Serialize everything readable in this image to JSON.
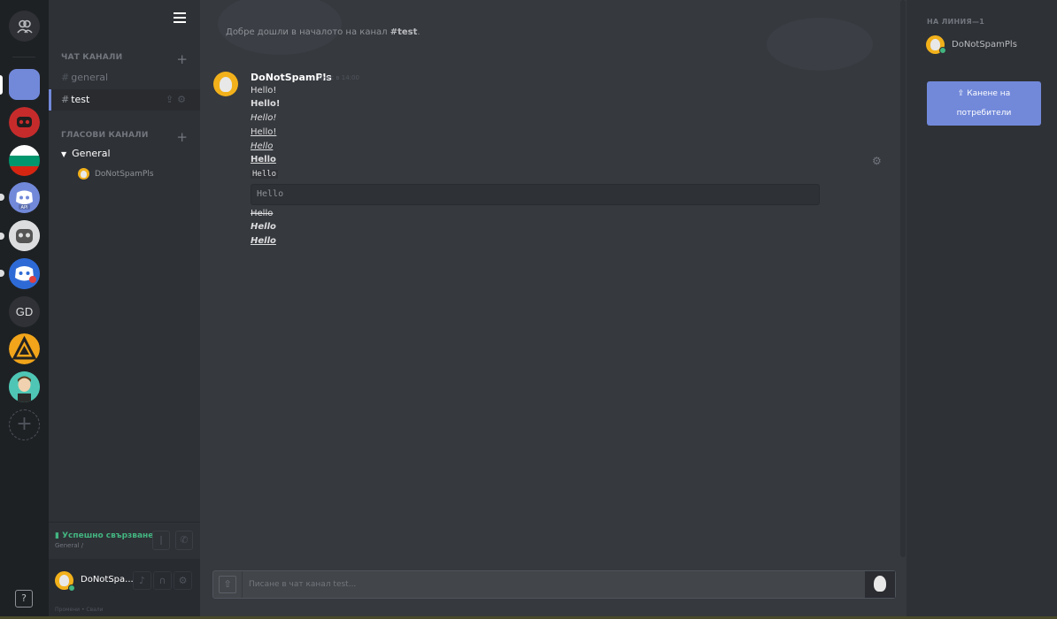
{
  "guilds": {
    "help_label": "?",
    "gd_initials": "GD",
    "add_label": "+"
  },
  "channels": {
    "text_category": "ЧАТ КАНАЛИ",
    "voice_category": "ГЛАСОВИ КАНАЛИ",
    "text_channels": [
      {
        "name": "general"
      },
      {
        "name": "test"
      }
    ],
    "voice_channel": "General",
    "voice_user": "DoNotSpamPls",
    "voice_status": "Успешно свързване",
    "voice_sub": "General /",
    "user_name": "DoNotSpa...",
    "footer": "Промени • Свали"
  },
  "chat": {
    "welcome_prefix": "Добре дошли в началото на канал ",
    "welcome_channel": "#test",
    "welcome_suffix": ".",
    "message": {
      "author": "DoNotSpamPls",
      "timestamp": "Днес в 14:00",
      "lines": [
        "Hello!",
        "Hello!",
        "Hello!",
        "Hello!",
        "Hello",
        "Hello",
        "Hello",
        "Hello",
        "Hello",
        "Hello",
        "Hello"
      ]
    },
    "input_placeholder": "Писане в чат канал test..."
  },
  "members": {
    "header": "НА ЛИНИЯ—1",
    "online": [
      {
        "name": "DoNotSpamPls"
      }
    ],
    "invite_line1": "Канене на",
    "invite_line2": "потребители"
  },
  "colors": {
    "accent": "#7289da",
    "online": "#43b581",
    "chat_bg": "#36393e",
    "sidebar_bg": "#2e3136",
    "guild_bg": "#1e2124"
  }
}
